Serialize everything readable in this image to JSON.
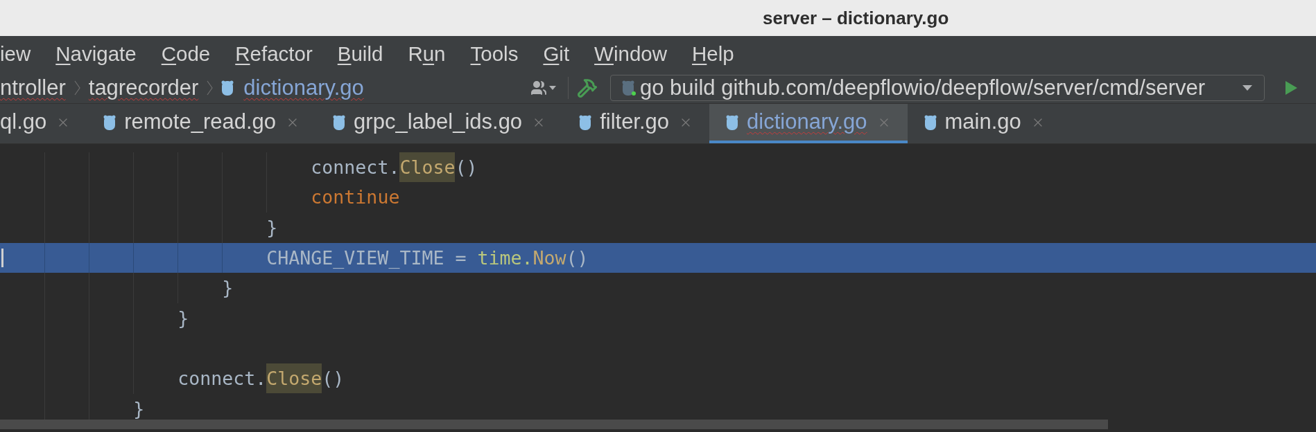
{
  "window": {
    "title": "server – dictionary.go"
  },
  "menu": [
    {
      "parts": [
        {
          "text": "iew",
          "underlined": false
        }
      ]
    },
    {
      "parts": [
        {
          "text": "N",
          "underlined": true
        },
        {
          "text": "avigate",
          "underlined": false
        }
      ]
    },
    {
      "parts": [
        {
          "text": "C",
          "underlined": true
        },
        {
          "text": "ode",
          "underlined": false
        }
      ]
    },
    {
      "parts": [
        {
          "text": "R",
          "underlined": true
        },
        {
          "text": "efactor",
          "underlined": false
        }
      ]
    },
    {
      "parts": [
        {
          "text": "B",
          "underlined": true
        },
        {
          "text": "uild",
          "underlined": false
        }
      ]
    },
    {
      "parts": [
        {
          "text": "R",
          "underlined": false
        },
        {
          "text": "u",
          "underlined": true
        },
        {
          "text": "n",
          "underlined": false
        }
      ]
    },
    {
      "parts": [
        {
          "text": "T",
          "underlined": true
        },
        {
          "text": "ools",
          "underlined": false
        }
      ]
    },
    {
      "parts": [
        {
          "text": "G",
          "underlined": true
        },
        {
          "text": "it",
          "underlined": false
        }
      ]
    },
    {
      "parts": [
        {
          "text": "W",
          "underlined": true
        },
        {
          "text": "indow",
          "underlined": false
        }
      ]
    },
    {
      "parts": [
        {
          "text": "H",
          "underlined": true
        },
        {
          "text": "elp",
          "underlined": false
        }
      ]
    }
  ],
  "breadcrumb": [
    {
      "label": "ntroller",
      "kind": "folder",
      "misspelled": true
    },
    {
      "label": "tagrecorder",
      "kind": "folder",
      "misspelled": true
    },
    {
      "label": "dictionary.go",
      "kind": "file",
      "misspelled": true
    }
  ],
  "run_config": {
    "value": "go build github.com/deepflowio/deepflow/server/cmd/server"
  },
  "tabs": [
    {
      "label": "ql.go",
      "selected": false,
      "icon": false
    },
    {
      "label": "remote_read.go",
      "selected": false,
      "icon": true
    },
    {
      "label": "grpc_label_ids.go",
      "selected": false,
      "icon": true
    },
    {
      "label": "filter.go",
      "selected": false,
      "icon": true
    },
    {
      "label": "dictionary.go",
      "selected": true,
      "icon": true
    },
    {
      "label": "main.go",
      "selected": false,
      "icon": true
    }
  ],
  "editor": {
    "lines": [
      {
        "selected": false,
        "blank": false,
        "tokens": [
          {
            "kind": "plain",
            "text": "                            connect."
          },
          {
            "kind": "method",
            "text": "Close",
            "highlighted": true
          },
          {
            "kind": "plain",
            "text": "()"
          }
        ]
      },
      {
        "selected": false,
        "blank": false,
        "tokens": [
          {
            "kind": "keyword",
            "text": "                            continue"
          }
        ]
      },
      {
        "selected": false,
        "blank": false,
        "tokens": [
          {
            "kind": "plain",
            "text": "                        }"
          }
        ]
      },
      {
        "selected": true,
        "blank": false,
        "tokens": [
          {
            "kind": "plain",
            "text": "                        CHANGE_VIEW_TIME = "
          },
          {
            "kind": "package",
            "text": "time."
          },
          {
            "kind": "method",
            "text": "Now",
            "highlighted": false
          },
          {
            "kind": "plain",
            "text": "()"
          }
        ]
      },
      {
        "selected": false,
        "blank": false,
        "tokens": [
          {
            "kind": "plain",
            "text": "                    }"
          }
        ]
      },
      {
        "selected": false,
        "blank": false,
        "tokens": [
          {
            "kind": "plain",
            "text": "                }"
          }
        ]
      },
      {
        "selected": false,
        "blank": true
      },
      {
        "selected": false,
        "blank": false,
        "tokens": [
          {
            "kind": "plain",
            "text": "                connect."
          },
          {
            "kind": "method",
            "text": "Close",
            "highlighted": true
          },
          {
            "kind": "plain",
            "text": "()"
          }
        ]
      },
      {
        "selected": false,
        "blank": false,
        "tokens": [
          {
            "kind": "plain",
            "text": "            }"
          }
        ]
      }
    ]
  }
}
